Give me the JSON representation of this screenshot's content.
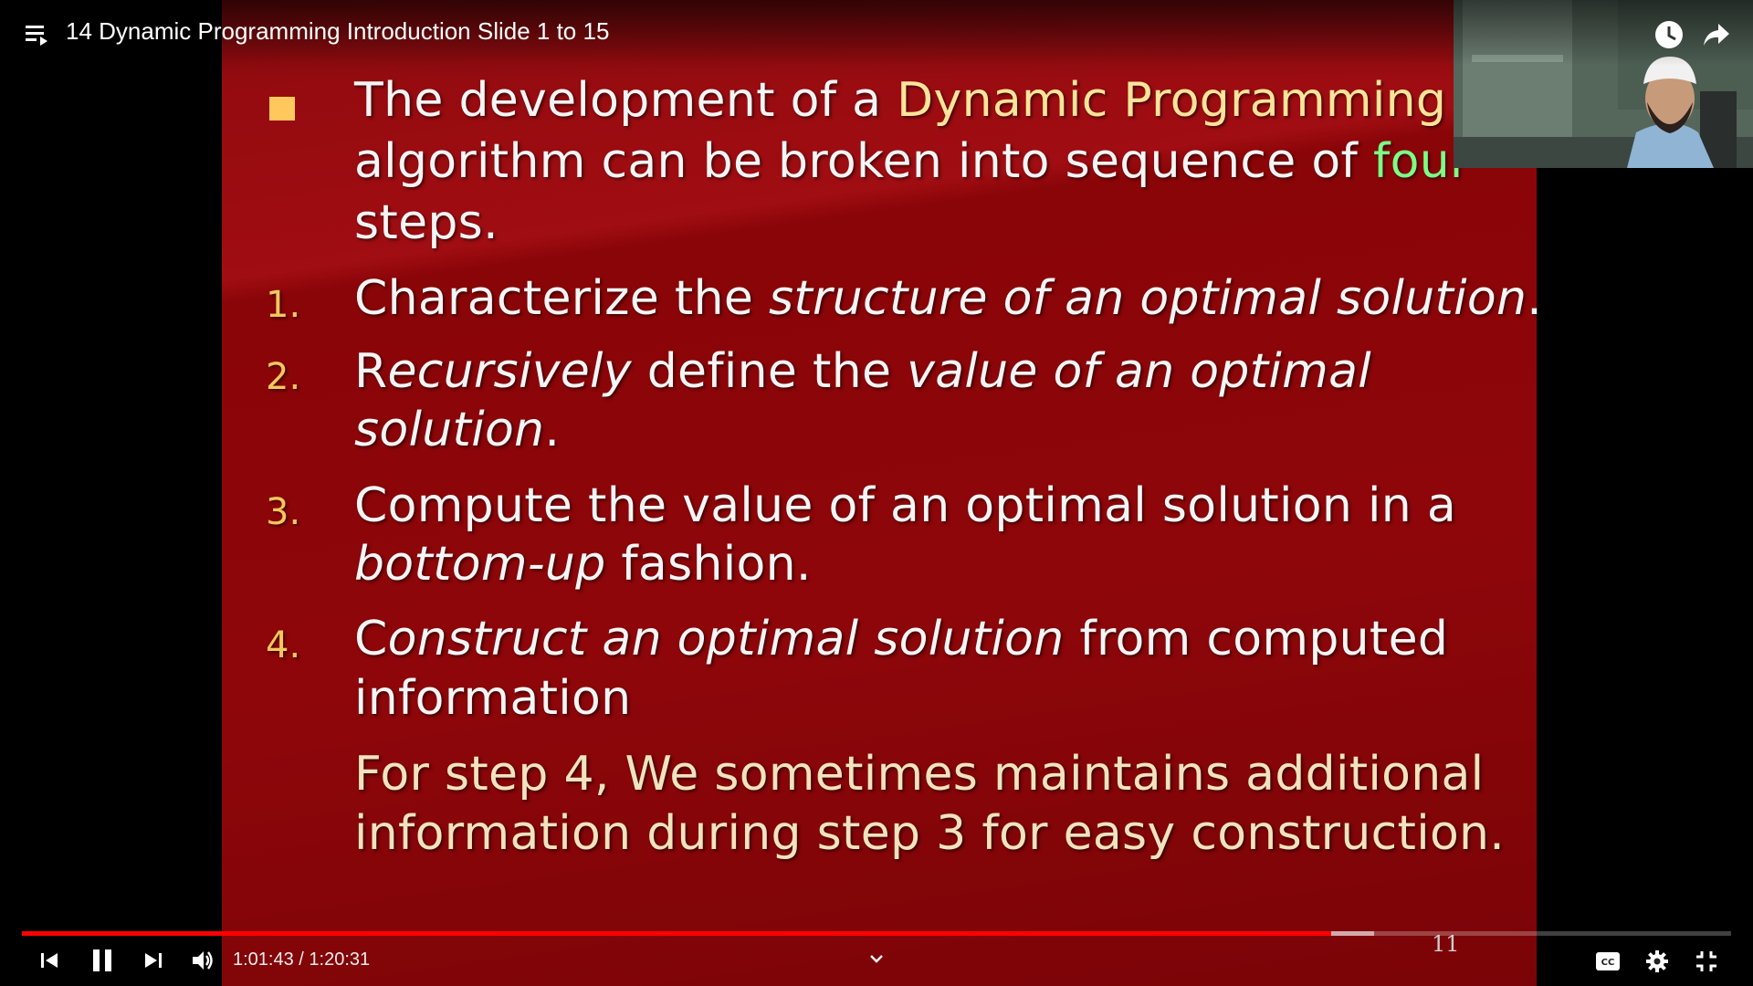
{
  "player": {
    "video_title": "14 Dynamic Programming Introduction Slide 1 to 15",
    "current_time": "1:01:43",
    "separator": "/",
    "duration": "1:20:31",
    "progress_fraction": 0.7662,
    "buffered_fraction": 0.791,
    "accent_color": "#ff0000",
    "icons": {
      "playlist": "playlist-icon",
      "watch_later": "clock-icon",
      "share": "share-icon",
      "previous": "previous-icon",
      "pause": "pause-icon",
      "next": "next-icon",
      "volume": "volume-icon",
      "chevron": "chevron-down-icon",
      "captions": "captions-icon",
      "settings": "gear-icon",
      "exit_fullscreen": "exit-fullscreen-icon"
    }
  },
  "slide": {
    "intro": {
      "p1": "The development of a ",
      "hl1": "Dynamic Programming",
      "p2": "algorithm can be broken into sequence of ",
      "hl2": "four",
      "p3": "steps."
    },
    "steps": [
      {
        "num": "1.",
        "a": "Characterize the ",
        "b": "structure of an optimal solution",
        "c": "."
      },
      {
        "num": "2.",
        "a": "R",
        "b": "ecursively",
        "c": " define the ",
        "d": "value of an optimal",
        "e": "solution",
        "f": "."
      },
      {
        "num": "3.",
        "a": "Compute the value of an optimal solution in a",
        "b": "bottom-up",
        "c": " fashion."
      },
      {
        "num": "4.",
        "a": "C",
        "b": "onstruct an optimal solution",
        "c": " from computed",
        "d": "information"
      }
    ],
    "note_line1": "For step 4, We sometimes maintains additional",
    "note_line2": "information during step 3 for easy construction.",
    "slide_number": "11",
    "colors": {
      "background": "#8e060a",
      "highlight_yellow": "#ffe49a",
      "highlight_green": "#7cff84",
      "number_color": "#f2c85e"
    }
  }
}
